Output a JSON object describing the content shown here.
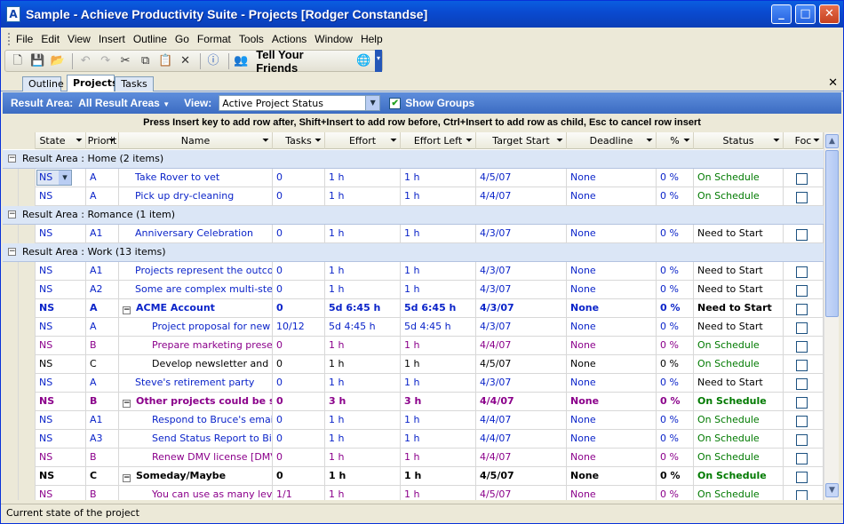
{
  "window": {
    "title": "Sample - Achieve Productivity Suite - Projects [Rodger Constandse]",
    "app_icon": "A"
  },
  "menu": [
    "File",
    "Edit",
    "View",
    "Insert",
    "Outline",
    "Go",
    "Format",
    "Tools",
    "Actions",
    "Window",
    "Help"
  ],
  "toolbar": {
    "tell_friends": "Tell Your Friends"
  },
  "tabs": [
    "Outline",
    "Projects",
    "Tasks"
  ],
  "filter": {
    "result_label": "Result Area:",
    "result_value": "All Result Areas",
    "view_label": "View:",
    "view_value": "Active Project Status",
    "show_groups": "Show Groups"
  },
  "hint": "Press Insert key to add row after, Shift+Insert to add row before, Ctrl+Insert to add row as child, Esc to cancel row insert",
  "columns": [
    "State",
    "Priorit",
    "Name",
    "Tasks",
    "Effort",
    "Effort Left",
    "Target Start",
    "Deadline",
    "%",
    "Status",
    "Foc"
  ],
  "groups": [
    {
      "label": "Result Area : Home (2 items)",
      "rows": [
        {
          "state": "NS",
          "pri": "A",
          "name": "Take Rover to vet",
          "tasks": "0",
          "effort": "1 h",
          "left": "1 h",
          "start": "4/5/07",
          "deadline": "None",
          "pct": "0 %",
          "status": "On Schedule",
          "indent": 1,
          "color": "blue",
          "status_color": "green",
          "bold": false,
          "expander": false,
          "editing": true
        },
        {
          "state": "NS",
          "pri": "A",
          "name": "Pick up dry-cleaning",
          "tasks": "0",
          "effort": "1 h",
          "left": "1 h",
          "start": "4/4/07",
          "deadline": "None",
          "pct": "0 %",
          "status": "On Schedule",
          "indent": 1,
          "color": "blue",
          "status_color": "green",
          "bold": false,
          "expander": false,
          "editing": false
        }
      ]
    },
    {
      "label": "Result Area : Romance (1 item)",
      "rows": [
        {
          "state": "NS",
          "pri": "A1",
          "name": "Anniversary Celebration",
          "tasks": "0",
          "effort": "1 h",
          "left": "1 h",
          "start": "4/3/07",
          "deadline": "None",
          "pct": "0 %",
          "status": "Need to Start",
          "indent": 1,
          "color": "blue",
          "status_color": "black",
          "bold": false,
          "expander": false,
          "editing": false
        }
      ]
    },
    {
      "label": "Result Area : Work (13 items)",
      "rows": [
        {
          "state": "NS",
          "pri": "A1",
          "name": "Projects represent the outcom",
          "tasks": "0",
          "effort": "1 h",
          "left": "1 h",
          "start": "4/3/07",
          "deadline": "None",
          "pct": "0 %",
          "status": "Need to Start",
          "indent": 1,
          "color": "blue",
          "status_color": "black",
          "bold": false,
          "expander": false,
          "editing": false
        },
        {
          "state": "NS",
          "pri": "A2",
          "name": "Some are complex multi-step",
          "tasks": "0",
          "effort": "1 h",
          "left": "1 h",
          "start": "4/3/07",
          "deadline": "None",
          "pct": "0 %",
          "status": "Need to Start",
          "indent": 1,
          "color": "blue",
          "status_color": "black",
          "bold": false,
          "expander": false,
          "editing": false
        },
        {
          "state": "NS",
          "pri": "A",
          "name": "ACME Account",
          "tasks": "0",
          "effort": "5d 6:45 h",
          "left": "5d 6:45 h",
          "start": "4/3/07",
          "deadline": "None",
          "pct": "0 %",
          "status": "Need to Start",
          "indent": 0,
          "color": "blue",
          "status_color": "black",
          "bold": true,
          "expander": true,
          "editing": false
        },
        {
          "state": "NS",
          "pri": "A",
          "name": "Project proposal for new j",
          "tasks": "10/12",
          "effort": "5d 4:45 h",
          "left": "5d 4:45 h",
          "start": "4/3/07",
          "deadline": "None",
          "pct": "0 %",
          "status": "Need to Start",
          "indent": 2,
          "color": "blue",
          "status_color": "black",
          "bold": false,
          "expander": false,
          "editing": false
        },
        {
          "state": "NS",
          "pri": "B",
          "name": "Prepare marketing presen",
          "tasks": "0",
          "effort": "1 h",
          "left": "1 h",
          "start": "4/4/07",
          "deadline": "None",
          "pct": "0 %",
          "status": "On Schedule",
          "indent": 2,
          "color": "purple",
          "status_color": "green",
          "bold": false,
          "expander": false,
          "editing": false
        },
        {
          "state": "NS",
          "pri": "C",
          "name": "Develop newsletter and m",
          "tasks": "0",
          "effort": "1 h",
          "left": "1 h",
          "start": "4/5/07",
          "deadline": "None",
          "pct": "0 %",
          "status": "On Schedule",
          "indent": 2,
          "color": "black",
          "status_color": "green",
          "bold": false,
          "expander": false,
          "editing": false
        },
        {
          "state": "NS",
          "pri": "A",
          "name": "Steve's retirement party",
          "tasks": "0",
          "effort": "1 h",
          "left": "1 h",
          "start": "4/3/07",
          "deadline": "None",
          "pct": "0 %",
          "status": "Need to Start",
          "indent": 1,
          "color": "blue",
          "status_color": "black",
          "bold": false,
          "expander": false,
          "editing": false
        },
        {
          "state": "NS",
          "pri": "B",
          "name": "Other projects could be simp",
          "tasks": "0",
          "effort": "3 h",
          "left": "3 h",
          "start": "4/4/07",
          "deadline": "None",
          "pct": "0 %",
          "status": "On Schedule",
          "indent": 0,
          "color": "purple",
          "status_color": "green",
          "bold": true,
          "expander": true,
          "editing": false
        },
        {
          "state": "NS",
          "pri": "A1",
          "name": "Respond to Bruce's email",
          "tasks": "0",
          "effort": "1 h",
          "left": "1 h",
          "start": "4/4/07",
          "deadline": "None",
          "pct": "0 %",
          "status": "On Schedule",
          "indent": 2,
          "color": "blue",
          "status_color": "green",
          "bold": false,
          "expander": false,
          "editing": false
        },
        {
          "state": "NS",
          "pri": "A3",
          "name": "Send Status Report to Bill",
          "tasks": "0",
          "effort": "1 h",
          "left": "1 h",
          "start": "4/4/07",
          "deadline": "None",
          "pct": "0 %",
          "status": "On Schedule",
          "indent": 2,
          "color": "blue",
          "status_color": "green",
          "bold": false,
          "expander": false,
          "editing": false
        },
        {
          "state": "NS",
          "pri": "B",
          "name": "Renew DMV license [DMV",
          "tasks": "0",
          "effort": "1 h",
          "left": "1 h",
          "start": "4/4/07",
          "deadline": "None",
          "pct": "0 %",
          "status": "On Schedule",
          "indent": 2,
          "color": "purple",
          "status_color": "green",
          "bold": false,
          "expander": false,
          "editing": false
        },
        {
          "state": "NS",
          "pri": "C",
          "name": "Someday/Maybe",
          "tasks": "0",
          "effort": "1 h",
          "left": "1 h",
          "start": "4/5/07",
          "deadline": "None",
          "pct": "0 %",
          "status": "On Schedule",
          "indent": 0,
          "color": "black",
          "status_color": "green",
          "bold": true,
          "expander": true,
          "editing": false
        },
        {
          "state": "NS",
          "pri": "B",
          "name": "You can use as many leve",
          "tasks": "1/1",
          "effort": "1 h",
          "left": "1 h",
          "start": "4/5/07",
          "deadline": "None",
          "pct": "0 %",
          "status": "On Schedule",
          "indent": 2,
          "color": "purple",
          "status_color": "green",
          "bold": false,
          "expander": false,
          "editing": false
        }
      ]
    }
  ],
  "colors": {
    "blue": "#0b24c9",
    "purple": "#8b008b",
    "black": "#000000",
    "green": "#007a00"
  },
  "statusbar": "Current state of the project"
}
